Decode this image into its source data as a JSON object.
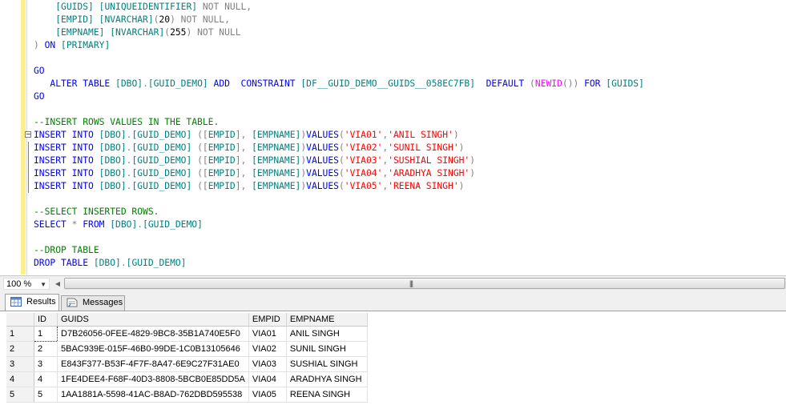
{
  "editor": {
    "lines": [
      {
        "segs": [
          [
            "    ",
            "t-gray"
          ],
          [
            "[GUIDS]",
            "t-teal"
          ],
          [
            " ",
            "t-black"
          ],
          [
            "[UNIQUEIDENTIFIER]",
            "t-teal"
          ],
          [
            " NOT NULL,",
            "t-gray"
          ]
        ]
      },
      {
        "segs": [
          [
            "    ",
            "t-gray"
          ],
          [
            "[EMPID]",
            "t-teal"
          ],
          [
            " ",
            "t-black"
          ],
          [
            "[NVARCHAR]",
            "t-teal"
          ],
          [
            "(",
            "t-gray"
          ],
          [
            "20",
            "t-black"
          ],
          [
            ") NOT NULL,",
            "t-gray"
          ]
        ]
      },
      {
        "segs": [
          [
            "    ",
            "t-gray"
          ],
          [
            "[EMPNAME]",
            "t-teal"
          ],
          [
            " ",
            "t-black"
          ],
          [
            "[NVARCHAR]",
            "t-teal"
          ],
          [
            "(",
            "t-gray"
          ],
          [
            "255",
            "t-black"
          ],
          [
            ") NOT NULL",
            "t-gray"
          ]
        ]
      },
      {
        "segs": [
          [
            ") ",
            "t-gray"
          ],
          [
            "ON",
            "t-blue"
          ],
          [
            " ",
            "t-black"
          ],
          [
            "[PRIMARY]",
            "t-teal"
          ]
        ]
      },
      {
        "segs": []
      },
      {
        "segs": [
          [
            "GO",
            "t-blue"
          ]
        ]
      },
      {
        "segs": [
          [
            "   ",
            "t-black"
          ],
          [
            "ALTER TABLE",
            "t-blue"
          ],
          [
            " ",
            "t-black"
          ],
          [
            "[DBO]",
            "t-teal"
          ],
          [
            ".",
            "t-gray"
          ],
          [
            "[GUID_DEMO]",
            "t-teal"
          ],
          [
            " ",
            "t-black"
          ],
          [
            "ADD",
            "t-blue"
          ],
          [
            "  ",
            "t-black"
          ],
          [
            "CONSTRAINT",
            "t-blue"
          ],
          [
            " ",
            "t-black"
          ],
          [
            "[DF__GUID_DEMO__GUIDS__058EC7FB]",
            "t-teal"
          ],
          [
            "  ",
            "t-black"
          ],
          [
            "DEFAULT",
            "t-blue"
          ],
          [
            " (",
            "t-gray"
          ],
          [
            "NEWID",
            "t-mag"
          ],
          [
            "()) ",
            "t-gray"
          ],
          [
            "FOR",
            "t-blue"
          ],
          [
            " ",
            "t-black"
          ],
          [
            "[GUIDS]",
            "t-teal"
          ]
        ]
      },
      {
        "segs": [
          [
            "GO",
            "t-blue"
          ]
        ]
      },
      {
        "segs": []
      },
      {
        "segs": [
          [
            "--INSERT ROWS VALUES IN THE TABLE.",
            "t-green"
          ]
        ]
      },
      {
        "collapse": true,
        "segs": [
          [
            "INSERT INTO",
            "t-blue"
          ],
          [
            " ",
            "t-black"
          ],
          [
            "[DBO]",
            "t-teal"
          ],
          [
            ".",
            "t-gray"
          ],
          [
            "[GUID_DEMO]",
            "t-teal"
          ],
          [
            " ([",
            "t-gray"
          ],
          [
            "EMPID",
            "t-teal"
          ],
          [
            "], ",
            "t-gray"
          ],
          [
            "[EMPNAME]",
            "t-teal"
          ],
          [
            ")",
            "t-gray"
          ],
          [
            "VALUES",
            "t-blue"
          ],
          [
            "(",
            "t-gray"
          ],
          [
            "'VIA01'",
            "t-red"
          ],
          [
            ",",
            "t-gray"
          ],
          [
            "'ANIL SINGH'",
            "t-red"
          ],
          [
            ")",
            "t-gray"
          ]
        ]
      },
      {
        "guide": true,
        "segs": [
          [
            "INSERT INTO",
            "t-blue"
          ],
          [
            " ",
            "t-black"
          ],
          [
            "[DBO]",
            "t-teal"
          ],
          [
            ".",
            "t-gray"
          ],
          [
            "[GUID_DEMO]",
            "t-teal"
          ],
          [
            " ([",
            "t-gray"
          ],
          [
            "EMPID",
            "t-teal"
          ],
          [
            "], ",
            "t-gray"
          ],
          [
            "[EMPNAME]",
            "t-teal"
          ],
          [
            ")",
            "t-gray"
          ],
          [
            "VALUES",
            "t-blue"
          ],
          [
            "(",
            "t-gray"
          ],
          [
            "'VIA02'",
            "t-red"
          ],
          [
            ",",
            "t-gray"
          ],
          [
            "'SUNIL SINGH'",
            "t-red"
          ],
          [
            ")",
            "t-gray"
          ]
        ]
      },
      {
        "guide": true,
        "segs": [
          [
            "INSERT INTO",
            "t-blue"
          ],
          [
            " ",
            "t-black"
          ],
          [
            "[DBO]",
            "t-teal"
          ],
          [
            ".",
            "t-gray"
          ],
          [
            "[GUID_DEMO]",
            "t-teal"
          ],
          [
            " ([",
            "t-gray"
          ],
          [
            "EMPID",
            "t-teal"
          ],
          [
            "], ",
            "t-gray"
          ],
          [
            "[EMPNAME]",
            "t-teal"
          ],
          [
            ")",
            "t-gray"
          ],
          [
            "VALUES",
            "t-blue"
          ],
          [
            "(",
            "t-gray"
          ],
          [
            "'VIA03'",
            "t-red"
          ],
          [
            ",",
            "t-gray"
          ],
          [
            "'SUSHIAL SINGH'",
            "t-red"
          ],
          [
            ")",
            "t-gray"
          ]
        ]
      },
      {
        "guide": true,
        "segs": [
          [
            "INSERT INTO",
            "t-blue"
          ],
          [
            " ",
            "t-black"
          ],
          [
            "[DBO]",
            "t-teal"
          ],
          [
            ".",
            "t-gray"
          ],
          [
            "[GUID_DEMO]",
            "t-teal"
          ],
          [
            " ([",
            "t-gray"
          ],
          [
            "EMPID",
            "t-teal"
          ],
          [
            "], ",
            "t-gray"
          ],
          [
            "[EMPNAME]",
            "t-teal"
          ],
          [
            ")",
            "t-gray"
          ],
          [
            "VALUES",
            "t-blue"
          ],
          [
            "(",
            "t-gray"
          ],
          [
            "'VIA04'",
            "t-red"
          ],
          [
            ",",
            "t-gray"
          ],
          [
            "'ARADHYA SINGH'",
            "t-red"
          ],
          [
            ")",
            "t-gray"
          ]
        ]
      },
      {
        "guide": true,
        "segs": [
          [
            "INSERT INTO",
            "t-blue"
          ],
          [
            " ",
            "t-black"
          ],
          [
            "[DBO]",
            "t-teal"
          ],
          [
            ".",
            "t-gray"
          ],
          [
            "[GUID_DEMO]",
            "t-teal"
          ],
          [
            " ([",
            "t-gray"
          ],
          [
            "EMPID",
            "t-teal"
          ],
          [
            "], ",
            "t-gray"
          ],
          [
            "[EMPNAME]",
            "t-teal"
          ],
          [
            ")",
            "t-gray"
          ],
          [
            "VALUES",
            "t-blue"
          ],
          [
            "(",
            "t-gray"
          ],
          [
            "'VIA05'",
            "t-red"
          ],
          [
            ",",
            "t-gray"
          ],
          [
            "'REENA SINGH'",
            "t-red"
          ],
          [
            ")",
            "t-gray"
          ]
        ]
      },
      {
        "segs": []
      },
      {
        "segs": [
          [
            "--SELECT INSERTED ROWS.",
            "t-green"
          ]
        ]
      },
      {
        "segs": [
          [
            "SELECT",
            "t-blue"
          ],
          [
            " * ",
            "t-gray"
          ],
          [
            "FROM",
            "t-blue"
          ],
          [
            " ",
            "t-black"
          ],
          [
            "[DBO]",
            "t-teal"
          ],
          [
            ".",
            "t-gray"
          ],
          [
            "[GUID_DEMO]",
            "t-teal"
          ]
        ]
      },
      {
        "segs": []
      },
      {
        "segs": [
          [
            "--DROP TABLE",
            "t-green"
          ]
        ]
      },
      {
        "segs": [
          [
            "DROP TABLE",
            "t-blue"
          ],
          [
            " ",
            "t-black"
          ],
          [
            "[DBO]",
            "t-teal"
          ],
          [
            ".",
            "t-gray"
          ],
          [
            "[GUID_DEMO]",
            "t-teal"
          ]
        ]
      }
    ]
  },
  "zoom": {
    "value": "100 %",
    "arrow_icon": "dropdown-arrow-icon"
  },
  "tabs": {
    "results": "Results",
    "messages": "Messages"
  },
  "grid": {
    "columns": [
      "ID",
      "GUIDS",
      "EMPID",
      "EMPNAME"
    ],
    "rows": [
      {
        "rownum": "1",
        "cells": [
          "1",
          "D7B26056-0FEE-4829-9BC8-35B1A740E5F0",
          "VIA01",
          "ANIL SINGH"
        ]
      },
      {
        "rownum": "2",
        "cells": [
          "2",
          "5BAC939E-015F-46B0-99DE-1C0B13105646",
          "VIA02",
          "SUNIL SINGH"
        ]
      },
      {
        "rownum": "3",
        "cells": [
          "3",
          "E843F377-B53F-4F7F-8A47-6E9C27F31AE0",
          "VIA03",
          "SUSHIAL SINGH"
        ]
      },
      {
        "rownum": "4",
        "cells": [
          "4",
          "1FE4DEE4-F68F-40D3-8808-5BCB0E85DD5A",
          "VIA04",
          "ARADHYA SINGH"
        ]
      },
      {
        "rownum": "5",
        "cells": [
          "5",
          "1AA1881A-5598-41AC-B8AD-762DBD595538",
          "VIA05",
          "REENA SINGH"
        ]
      }
    ]
  }
}
